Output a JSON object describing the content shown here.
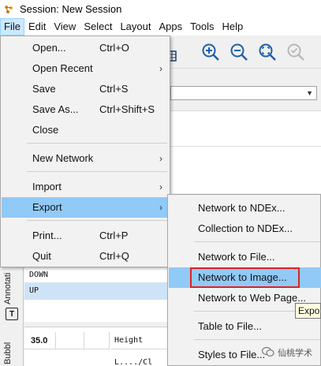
{
  "window": {
    "title": "Session: New Session"
  },
  "menubar": {
    "items": [
      "File",
      "Edit",
      "View",
      "Select",
      "Layout",
      "Apps",
      "Tools",
      "Help"
    ]
  },
  "file_menu": {
    "open": {
      "label": "Open...",
      "shortcut": "Ctrl+O"
    },
    "open_recent": {
      "label": "Open Recent"
    },
    "save": {
      "label": "Save",
      "shortcut": "Ctrl+S"
    },
    "save_as": {
      "label": "Save As...",
      "shortcut": "Ctrl+Shift+S"
    },
    "close": {
      "label": "Close"
    },
    "new_network": {
      "label": "New Network"
    },
    "import": {
      "label": "Import"
    },
    "export": {
      "label": "Export"
    },
    "print": {
      "label": "Print...",
      "shortcut": "Ctrl+P"
    },
    "quit": {
      "label": "Quit",
      "shortcut": "Ctrl+Q"
    }
  },
  "export_menu": {
    "items": [
      "Network to NDEx...",
      "Collection to NDEx...",
      "Network to File...",
      "Network to Image...",
      "Network to Web Page...",
      "Table to File...",
      "Styles to File..."
    ]
  },
  "tooltip": {
    "text": "Expo"
  },
  "side_tabs": {
    "annotation": "Annotati",
    "bubble": "Bubbl"
  },
  "list": {
    "rows": [
      "DOWN",
      "UP"
    ]
  },
  "table": {
    "value": "35.0",
    "property": "Height",
    "next_row_text": "L..../Cl"
  },
  "watermark": {
    "text": "仙桃学术"
  },
  "colors": {
    "highlight": "#91c9f7",
    "red_outline": "#e02020",
    "icon_blue": "#1f5fa8"
  }
}
